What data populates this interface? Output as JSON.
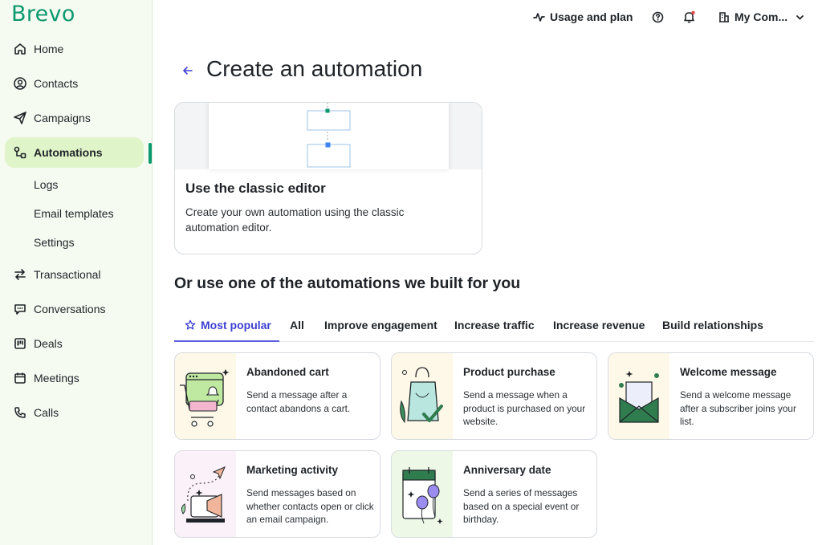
{
  "app": {
    "logo": "Brevo"
  },
  "sidebar": {
    "items": [
      {
        "label": "Home",
        "icon": "home-icon"
      },
      {
        "label": "Contacts",
        "icon": "contacts-icon"
      },
      {
        "label": "Campaigns",
        "icon": "send-icon"
      },
      {
        "label": "Automations",
        "icon": "automation-icon",
        "active": true
      },
      {
        "label": "Transactional",
        "icon": "transfer-icon"
      },
      {
        "label": "Conversations",
        "icon": "chat-icon"
      },
      {
        "label": "Deals",
        "icon": "kanban-icon"
      },
      {
        "label": "Meetings",
        "icon": "calendar-icon"
      },
      {
        "label": "Calls",
        "icon": "phone-icon"
      }
    ],
    "subitems": [
      {
        "label": "Logs"
      },
      {
        "label": "Email templates"
      },
      {
        "label": "Settings"
      }
    ]
  },
  "topbar": {
    "usage": "Usage and plan",
    "company": "My Com..."
  },
  "header": {
    "title": "Create an automation"
  },
  "classic": {
    "title": "Use the classic editor",
    "description": "Create your own automation using the classic automation editor."
  },
  "section": {
    "title": "Or use one of the automations we built for you"
  },
  "tabs": [
    {
      "label": "Most popular",
      "active": true
    },
    {
      "label": "All"
    },
    {
      "label": "Improve engagement"
    },
    {
      "label": "Increase traffic"
    },
    {
      "label": "Increase revenue"
    },
    {
      "label": "Build relationships"
    }
  ],
  "templates": [
    {
      "title": "Abandoned cart",
      "description": "Send a message after a contact abandons a cart.",
      "illustration": "cart-illustration",
      "bg": "#fdf8e8"
    },
    {
      "title": "Product purchase",
      "description": "Send a message when a product is purchased on your website.",
      "illustration": "shopping-bag-illustration",
      "bg": "#fdf8e8"
    },
    {
      "title": "Welcome message",
      "description": "Send a welcome message after a subscriber joins your list.",
      "illustration": "envelope-illustration",
      "bg": "#fdf8e8"
    },
    {
      "title": "Marketing activity",
      "description": "Send messages based on whether contacts open or click an email campaign.",
      "illustration": "megaphone-illustration",
      "bg": "#fbf1f8"
    },
    {
      "title": "Anniversary date",
      "description": "Send a series of messages based on a special event or birthday.",
      "illustration": "balloons-illustration",
      "bg": "#eef8e6"
    }
  ],
  "colors": {
    "brand": "#0b996e",
    "accent": "#3b3fd1",
    "active_nav": "#dff5c9"
  }
}
